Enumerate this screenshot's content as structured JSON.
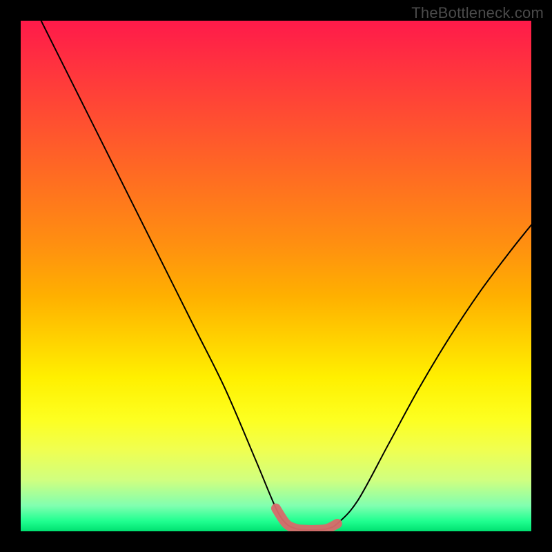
{
  "watermark": "TheBottleneck.com",
  "chart_data": {
    "type": "line",
    "title": "",
    "xlabel": "",
    "ylabel": "",
    "xlim": [
      0,
      100
    ],
    "ylim": [
      0,
      100
    ],
    "series": [
      {
        "name": "bottleneck-curve",
        "x": [
          4,
          10,
          16,
          22,
          28,
          34,
          40,
          46,
          50,
          52,
          54,
          56,
          58,
          60,
          62,
          66,
          72,
          78,
          84,
          90,
          96,
          100
        ],
        "values": [
          100,
          88,
          76,
          64,
          52,
          40,
          28,
          14,
          4.5,
          1.5,
          0.5,
          0.3,
          0.3,
          0.5,
          1.5,
          6,
          17,
          28,
          38,
          47,
          55,
          60
        ]
      },
      {
        "name": "highlight-band",
        "x": [
          50,
          52,
          54,
          56,
          58,
          60,
          62
        ],
        "values": [
          4.5,
          1.5,
          0.5,
          0.3,
          0.3,
          0.5,
          1.5
        ]
      }
    ],
    "gradient": {
      "top_color": "#ff1a4a",
      "mid_color": "#fff000",
      "bottom_color": "#00e070"
    }
  }
}
